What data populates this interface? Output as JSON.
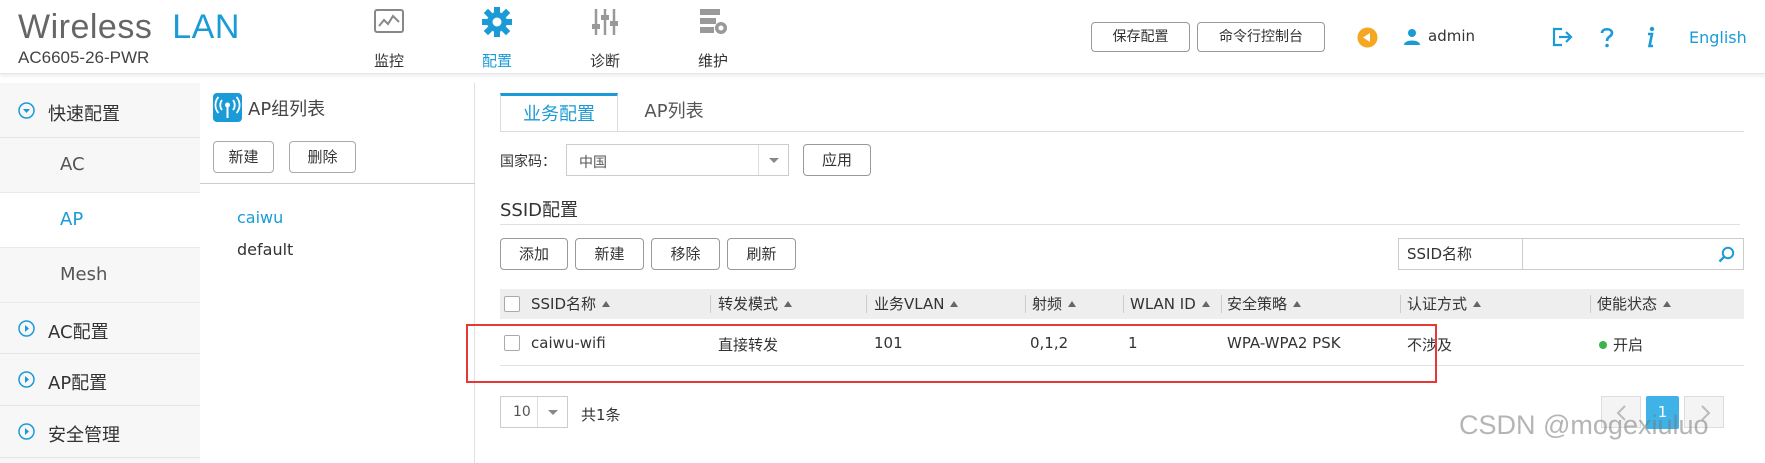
{
  "header": {
    "brand_part1": "Wireless",
    "brand_part2": "LAN",
    "model": "AC6605-26-PWR",
    "nav": [
      {
        "label": "监控",
        "icon": "monitor-icon"
      },
      {
        "label": "配置",
        "icon": "gear-icon",
        "active": true
      },
      {
        "label": "诊断",
        "icon": "sliders-icon"
      },
      {
        "label": "维护",
        "icon": "server-gear-icon"
      }
    ],
    "save_config_label": "保存配置",
    "cli_console_label": "命令行控制台",
    "user": "admin",
    "language": "English"
  },
  "sidebar": {
    "items": [
      {
        "label": "快速配置",
        "expanded": true
      },
      {
        "label": "AC",
        "sub": true
      },
      {
        "label": "AP",
        "sub": true,
        "active": true
      },
      {
        "label": "Mesh",
        "sub": true
      },
      {
        "label": "AC配置"
      },
      {
        "label": "AP配置"
      },
      {
        "label": "安全管理"
      }
    ]
  },
  "group_panel": {
    "title": "AP组列表",
    "new_label": "新建",
    "delete_label": "删除",
    "groups": [
      {
        "name": "caiwu",
        "active": true
      },
      {
        "name": "default"
      }
    ]
  },
  "main": {
    "tabs": [
      {
        "label": "业务配置",
        "active": true
      },
      {
        "label": "AP列表"
      }
    ],
    "country_label": "国家码：",
    "country_value": "中国",
    "apply_label": "应用",
    "section_title": "SSID配置",
    "toolbar": {
      "add": "添加",
      "new": "新建",
      "remove": "移除",
      "refresh": "刷新"
    },
    "search_label": "SSID名称",
    "table": {
      "columns": [
        "SSID名称",
        "转发模式",
        "业务VLAN",
        "射频",
        "WLAN ID",
        "安全策略",
        "认证方式",
        "使能状态"
      ],
      "rows": [
        [
          "caiwu-wifi",
          "直接转发",
          "101",
          "0,1,2",
          "1",
          "WPA-WPA2 PSK",
          "不涉及",
          "开启"
        ]
      ]
    },
    "page_size": "10",
    "total": "共1条",
    "current_page": "1"
  },
  "watermark": "CSDN @mogexiuluo",
  "colors": {
    "accent": "#1a9bd7",
    "highlight": "#e53935",
    "status_on": "#3bb34a",
    "notify": "#f5a623"
  }
}
